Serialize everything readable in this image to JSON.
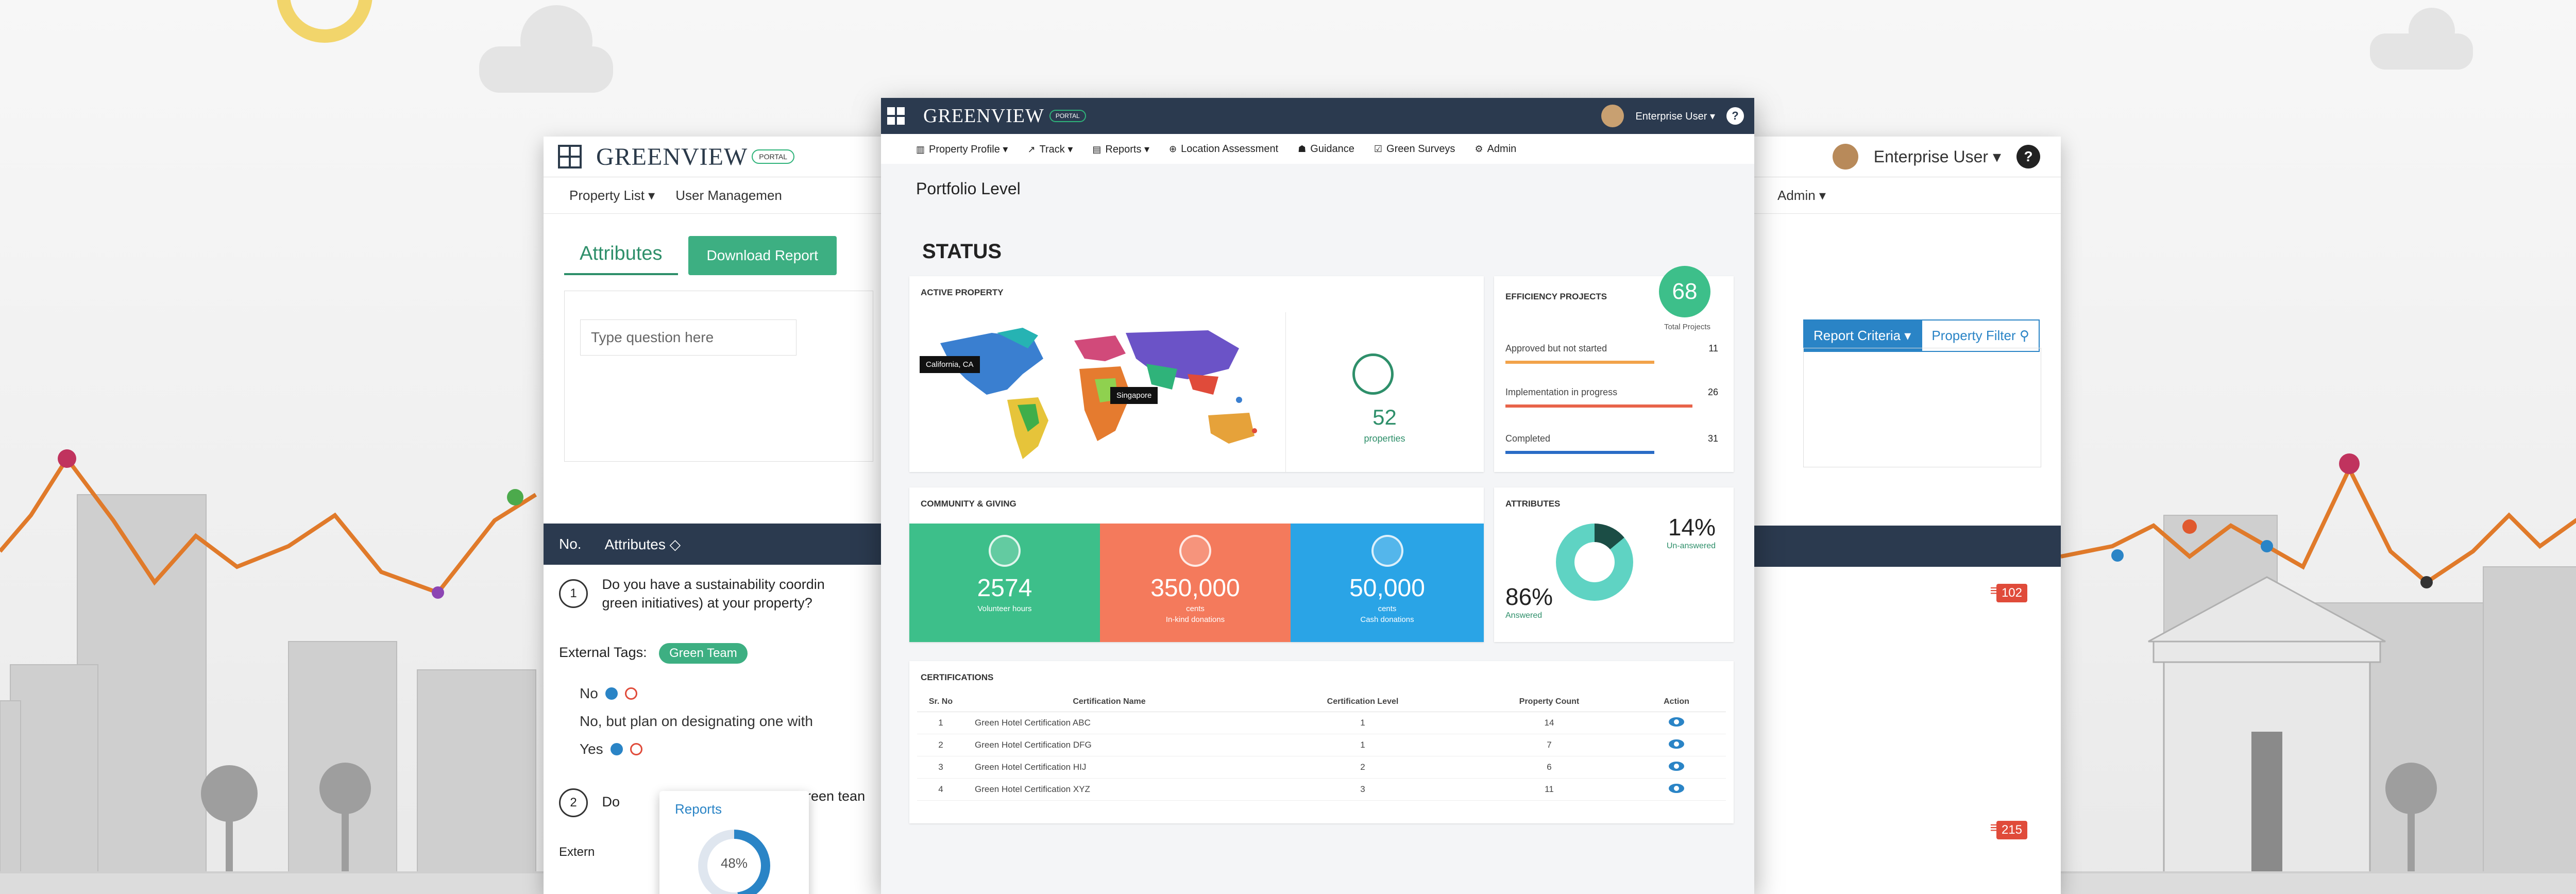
{
  "left_screen": {
    "logo": {
      "text": "GREENVIEW",
      "portal": "PORTAL"
    },
    "nav": {
      "property_list": "Property List ▾",
      "user_management": "User Managemen"
    },
    "tabs": {
      "attributes": "Attributes",
      "download_report": "Download Report"
    },
    "search": {
      "placeholder": "Type question here"
    },
    "table_header": {
      "no": "No.",
      "attributes": "Attributes ◇"
    },
    "q1": {
      "number": "1",
      "text": "Do you have a sustainability coordin green initiatives) at your property?"
    },
    "external_tags_label": "External Tags:",
    "tag": "Green Team",
    "options": [
      "No",
      "No, but plan on designating one with",
      "Yes"
    ],
    "q2": {
      "number": "2",
      "text_start": "Do",
      "text_end": "reen tean"
    },
    "external_label_partial": "Extern",
    "popup": {
      "title": "Reports",
      "value": "48%"
    }
  },
  "right_screen": {
    "user": "Enterprise User ▾",
    "help": "?",
    "nav_admin": "Admin ▾",
    "filters": {
      "criteria": "Report Criteria ▾",
      "property_filter": "Property Filter ⚲"
    },
    "badges": [
      "102",
      "215"
    ]
  },
  "center_screen": {
    "logo": {
      "text": "GREENVIEW",
      "portal": "PORTAL"
    },
    "user": "Enterprise User ▾",
    "help": "?",
    "nav": [
      {
        "icon": "▥",
        "label": "Property Profile ▾"
      },
      {
        "icon": "↗",
        "label": "Track ▾"
      },
      {
        "icon": "▤",
        "label": "Reports ▾"
      },
      {
        "icon": "⊕",
        "label": "Location Assessment"
      },
      {
        "icon": "☗",
        "label": "Guidance"
      },
      {
        "icon": "☑",
        "label": "Green Surveys"
      },
      {
        "icon": "⚙",
        "label": "Admin"
      }
    ],
    "page_title": "Portfolio Level",
    "status": "STATUS",
    "active_property": {
      "title": "ACTIVE PROPERTY",
      "labels": [
        "California, CA",
        "Singapore"
      ],
      "count": "52",
      "unit": "properties"
    },
    "efficiency": {
      "title": "EFFICIENCY PROJECTS",
      "total": "68",
      "total_label": "Total Projects",
      "items": [
        {
          "label": "Approved but not started",
          "value": "11"
        },
        {
          "label": "Implementation in progress",
          "value": "26"
        },
        {
          "label": "Completed",
          "value": "31"
        }
      ]
    },
    "community": {
      "title": "COMMUNITY & GIVING",
      "tiles": [
        {
          "value": "2574",
          "label": "Volunteer hours"
        },
        {
          "value": "350,000",
          "unit": "cents",
          "label": "In-kind donations"
        },
        {
          "value": "50,000",
          "unit": "cents",
          "label": "Cash donations"
        }
      ]
    },
    "attributes": {
      "title": "ATTRIBUTES",
      "unanswered_pct": "14%",
      "unanswered_label": "Un-answered",
      "answered_pct": "86%",
      "answered_label": "Answered"
    },
    "certifications": {
      "title": "CERTIFICATIONS",
      "columns": [
        "Sr. No",
        "Certification Name",
        "Certification Level",
        "Property Count",
        "Action"
      ],
      "rows": [
        [
          "1",
          "Green Hotel Certification ABC",
          "1",
          "14"
        ],
        [
          "2",
          "Green Hotel Certification DFG",
          "1",
          "7"
        ],
        [
          "3",
          "Green Hotel Certification HIJ",
          "2",
          "6"
        ],
        [
          "4",
          "Green Hotel Certification XYZ",
          "3",
          "11"
        ]
      ]
    }
  },
  "colors": {
    "navy": "#2b3a4f",
    "green": "#3dbf8a",
    "teal": "#3daf82",
    "orange": "#f47a5c",
    "blue": "#2aa4e6",
    "line": "#e07a2a",
    "red": "#e04b3a"
  }
}
